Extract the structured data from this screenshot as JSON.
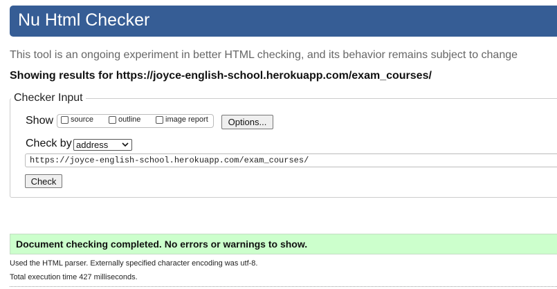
{
  "header": {
    "title": "Nu Html Checker"
  },
  "intro": "This tool is an ongoing experiment in better HTML checking, and its behavior remains subject to change",
  "results_for": "Showing results for https://joyce-english-school.herokuapp.com/exam_courses/",
  "checker_input": {
    "legend": "Checker Input",
    "show_label": "Show",
    "options": [
      {
        "label": "source",
        "checked": false
      },
      {
        "label": "outline",
        "checked": false
      },
      {
        "label": "image report",
        "checked": false
      }
    ],
    "options_button": "Options...",
    "check_by_label": "Check by",
    "check_by_value": "address",
    "url_value": "https://joyce-english-school.herokuapp.com/exam_courses/",
    "check_button": "Check"
  },
  "result": {
    "success_message": "Document checking completed. No errors or warnings to show.",
    "parser_info": "Used the HTML parser. Externally specified character encoding was utf-8.",
    "execution_time": "Total execution time 427 milliseconds."
  },
  "colors": {
    "header_bg": "#365d95",
    "success_bg": "#ccffcc"
  }
}
